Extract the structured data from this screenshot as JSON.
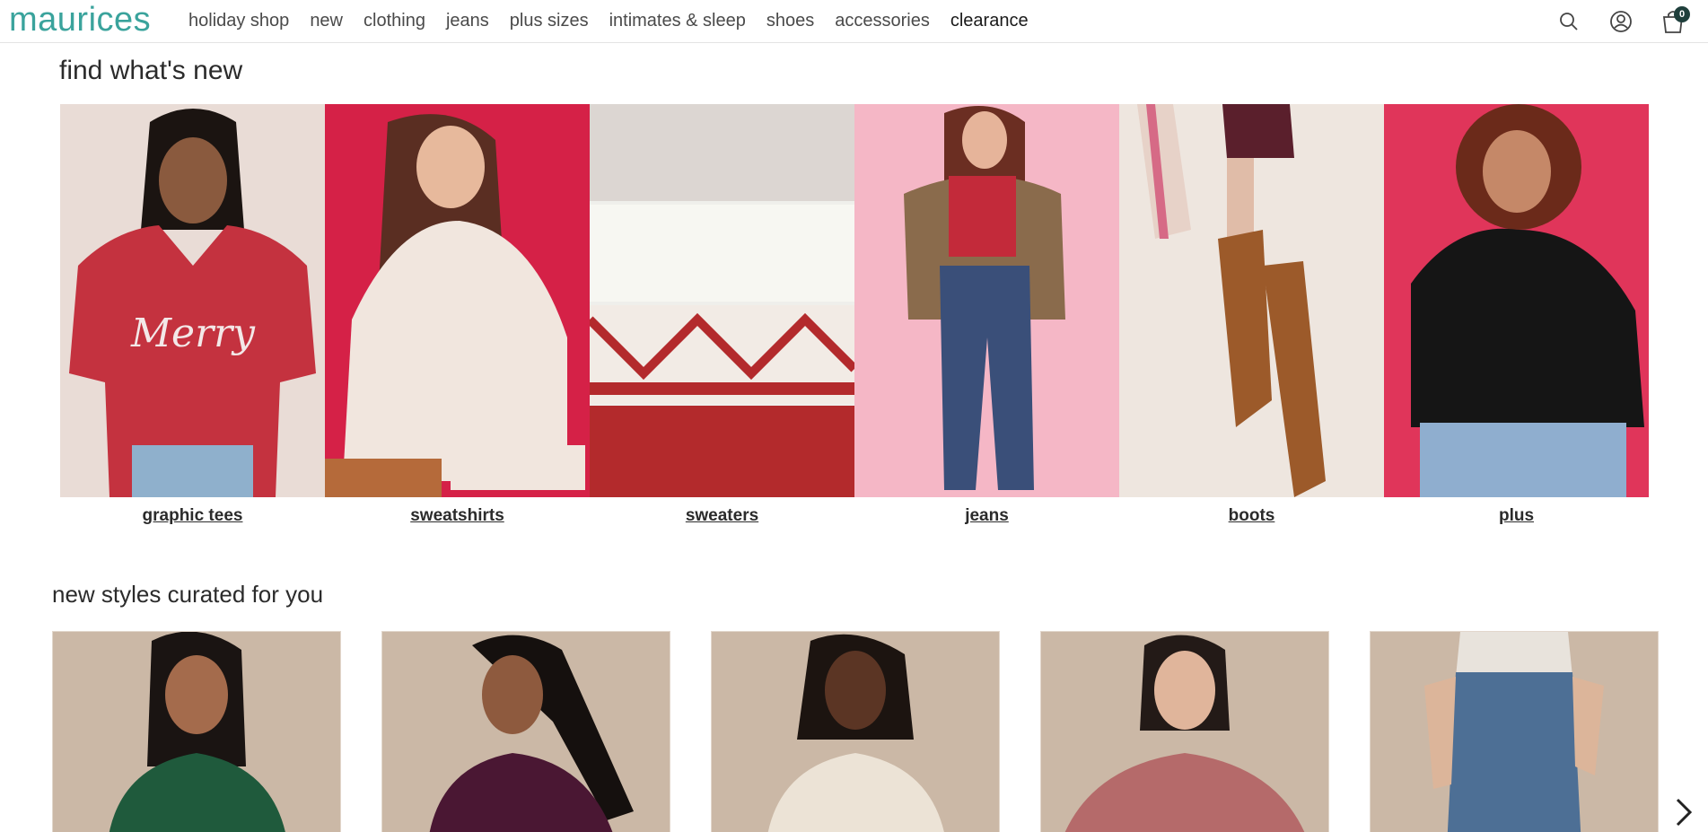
{
  "brand": {
    "name": "maurices",
    "color": "#3aa39c"
  },
  "nav": {
    "items": [
      "holiday shop",
      "new",
      "clothing",
      "jeans",
      "plus sizes",
      "intimates & sleep",
      "shoes",
      "accessories",
      "clearance"
    ]
  },
  "header_icons": [
    "search-icon",
    "account-icon",
    "cart-icon"
  ],
  "cart": {
    "count": "0"
  },
  "find_new": {
    "title": "find what's new",
    "categories": [
      {
        "label": "graphic tees",
        "bg": "#e9dcd6",
        "accent": "#c4323f"
      },
      {
        "label": "sweatshirts",
        "bg": "#d52147",
        "accent": "#f1e6de"
      },
      {
        "label": "sweaters",
        "bg": "#efefeb",
        "accent": "#b32a2c"
      },
      {
        "label": "jeans",
        "bg": "#f5b7c6",
        "accent": "#3a4f79"
      },
      {
        "label": "boots",
        "bg": "#eee6df",
        "accent": "#9c5a2a"
      },
      {
        "label": "plus",
        "bg": "#e0355a",
        "accent": "#151515"
      }
    ]
  },
  "curated": {
    "title": "new styles curated for you",
    "products": [
      {
        "top": "#1f5a3c",
        "skin": "#a46b4c",
        "hair": "#1a1412"
      },
      {
        "top": "#4a1733",
        "skin": "#8e5a3e",
        "hair": "#15100e"
      },
      {
        "top": "#ece3d6",
        "skin": "#5b3524",
        "hair": "#1c1410"
      },
      {
        "top": "#b56a6a",
        "skin": "#e0b59b",
        "hair": "#231a17"
      },
      {
        "top": "#4d6f95",
        "skin": "#dcb59a",
        "hair": "#e8e3dc"
      }
    ]
  },
  "carousel": {
    "next_icon": "chevron-right-icon"
  }
}
